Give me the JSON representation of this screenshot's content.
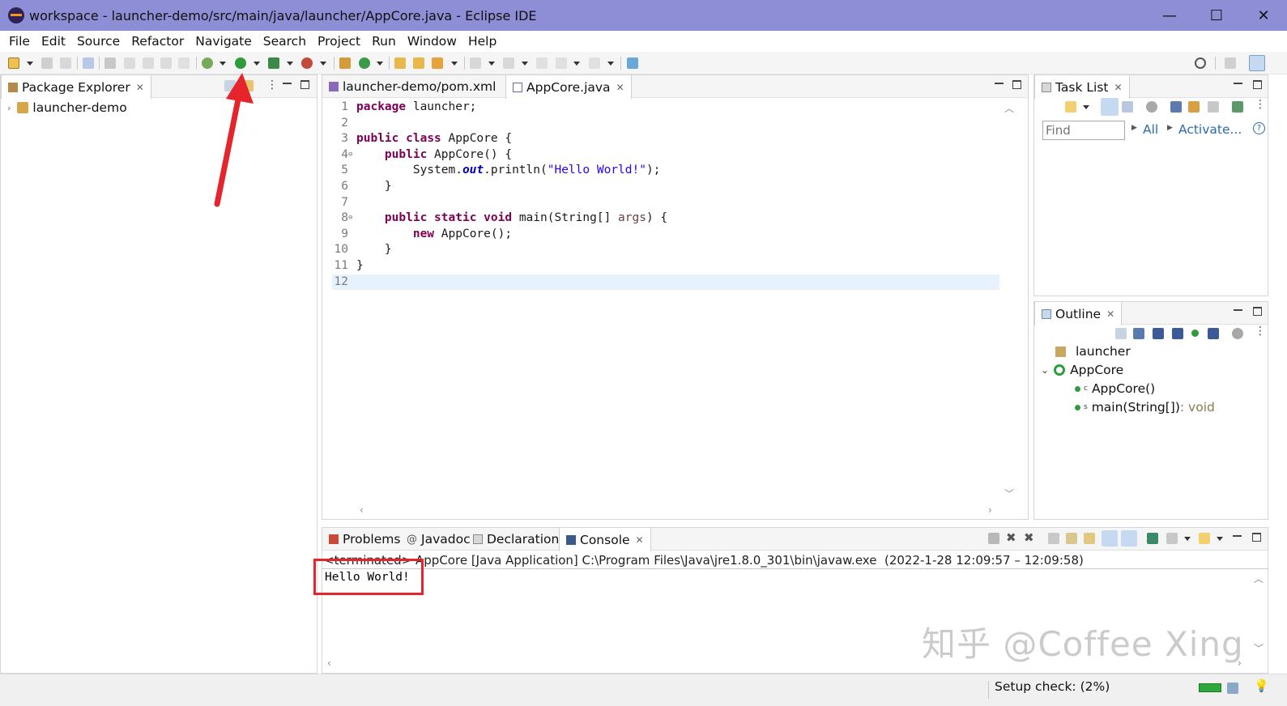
{
  "window": {
    "title": "workspace - launcher-demo/src/main/java/launcher/AppCore.java - Eclipse IDE",
    "controls": [
      "—",
      "☐",
      "✕"
    ]
  },
  "menubar": {
    "items": [
      "File",
      "Edit",
      "Source",
      "Refactor",
      "Navigate",
      "Search",
      "Project",
      "Run",
      "Window",
      "Help"
    ]
  },
  "package_explorer": {
    "tab_label": "Package Explorer",
    "project": "launcher-demo"
  },
  "editor": {
    "tabs": [
      {
        "label": "launcher-demo/pom.xml",
        "icon": "maven-file-icon"
      },
      {
        "label": "AppCore.java",
        "icon": "java-file-icon"
      }
    ],
    "line_numbers": [
      "1",
      "2",
      "3",
      "4",
      "5",
      "6",
      "7",
      "8",
      "9",
      "10",
      "11",
      "12"
    ],
    "code": {
      "l1_kw": "package",
      "l1_rest": " launcher;",
      "l3_kw1": "public",
      "l3_kw2": "class",
      "l3_rest": " AppCore {",
      "l4_kw": "public",
      "l4_rest": " AppCore() {",
      "l5_a": "System.",
      "l5_field": "out",
      "l5_b": ".println(",
      "l5_str": "\"Hello World!\"",
      "l5_c": ");",
      "l6": "}",
      "l8_kw1": "public",
      "l8_kw2": "static",
      "l8_kw3": "void",
      "l8_a": " main(String[] ",
      "l8_arg": "args",
      "l8_b": ") {",
      "l9_kw": "new",
      "l9_rest": " AppCore();",
      "l10": "}",
      "l11": "}"
    }
  },
  "task_list": {
    "tab_label": "Task List",
    "find_placeholder": "Find",
    "all_label": "All",
    "activate_label": "Activate..."
  },
  "outline": {
    "tab_label": "Outline",
    "package": "launcher",
    "class": "AppCore",
    "members": [
      {
        "label": "AppCore()",
        "modifier": "c",
        "type": ""
      },
      {
        "label": "main(String[])",
        "modifier": "s",
        "type": " : void"
      }
    ]
  },
  "bottom_panel": {
    "tabs": [
      "Problems",
      "Javadoc",
      "Declaration",
      "Console"
    ],
    "terminated_line": "<terminated> AppCore [Java Application] C:\\Program Files\\Java\\jre1.8.0_301\\bin\\javaw.exe  (2022-1-28 12:09:57 – 12:09:58)",
    "output": "Hello World!"
  },
  "status": {
    "setup_check": "Setup check: (2%)"
  },
  "watermark": "知乎 @Coffee Xing",
  "colors": {
    "titlebar": "#8e8ed6",
    "keyword": "#7f0055",
    "string": "#2a00ff",
    "annotation_red": "#e5252b",
    "run_green": "#2e9b3c"
  }
}
